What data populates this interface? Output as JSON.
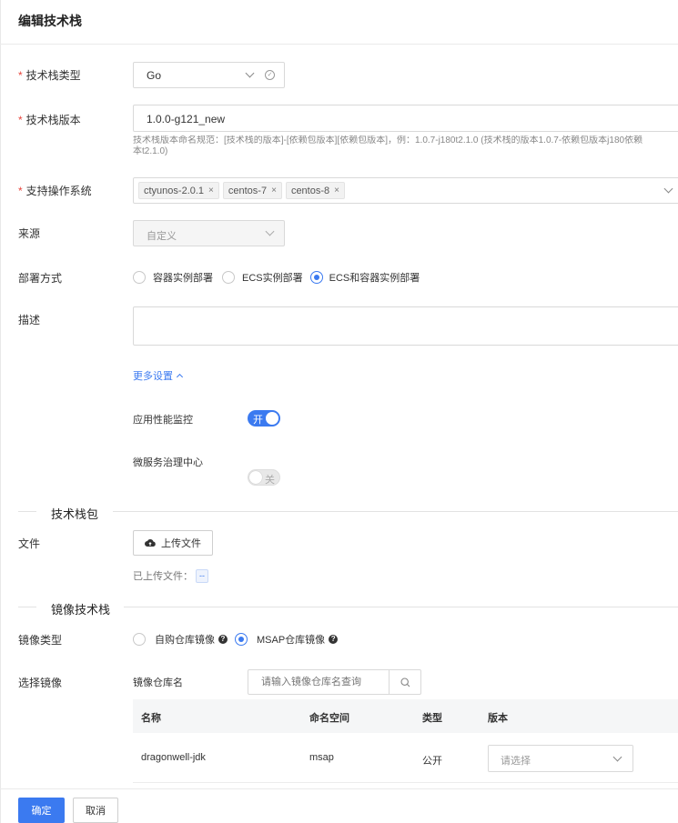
{
  "header": {
    "title": "编辑技术栈"
  },
  "form": {
    "stack_type": {
      "label": "技术栈类型",
      "value": "Go"
    },
    "stack_version": {
      "label": "技术栈版本",
      "value": "1.0.0-g121_new",
      "hint_line1": "技术栈版本命名规范：[技术栈的版本]-[依赖包版本][依赖包版本]，例：1.0.7-j180t2.1.0 (技术栈的版本1.0.7-依赖包版本j180依赖",
      "hint_line2": "本t2.1.0)"
    },
    "os": {
      "label": "支持操作系统",
      "chips": [
        "ctyunos-2.0.1",
        "centos-7",
        "centos-8"
      ],
      "remove": "×"
    },
    "source": {
      "label": "来源",
      "value": "自定义"
    },
    "deploy": {
      "label": "部署方式",
      "options": [
        "容器实例部署",
        "ECS实例部署",
        "ECS和容器实例部署"
      ],
      "selected": 2
    },
    "description": {
      "label": "描述",
      "value": ""
    },
    "more_settings": "更多设置",
    "apm": {
      "label": "应用性能监控",
      "state": "开"
    },
    "msc": {
      "label": "微服务治理中心",
      "state": "关"
    }
  },
  "package_section": {
    "title": "技术栈包",
    "file_label": "文件",
    "upload_button": "上传文件",
    "uploaded_label": "已上传文件：",
    "uploaded_value": "--"
  },
  "image_section": {
    "title": "镜像技术栈",
    "image_type_label": "镜像类型",
    "image_type_options": [
      "自购仓库镜像",
      "MSAP仓库镜像"
    ],
    "selected": 1,
    "help": "?",
    "select_image_label": "选择镜像",
    "repo_label": "镜像仓库名",
    "repo_placeholder": "请输入镜像仓库名查询",
    "table": {
      "headers": [
        "名称",
        "命名空间",
        "类型",
        "版本"
      ],
      "rows": [
        {
          "name": "dragonwell-jdk",
          "namespace": "msap",
          "type": "公开",
          "version_placeholder": "请选择"
        }
      ]
    }
  },
  "footer": {
    "confirm": "确定",
    "cancel": "取消"
  },
  "colors": {
    "primary": "#3b7af0",
    "required": "#e8453c"
  }
}
